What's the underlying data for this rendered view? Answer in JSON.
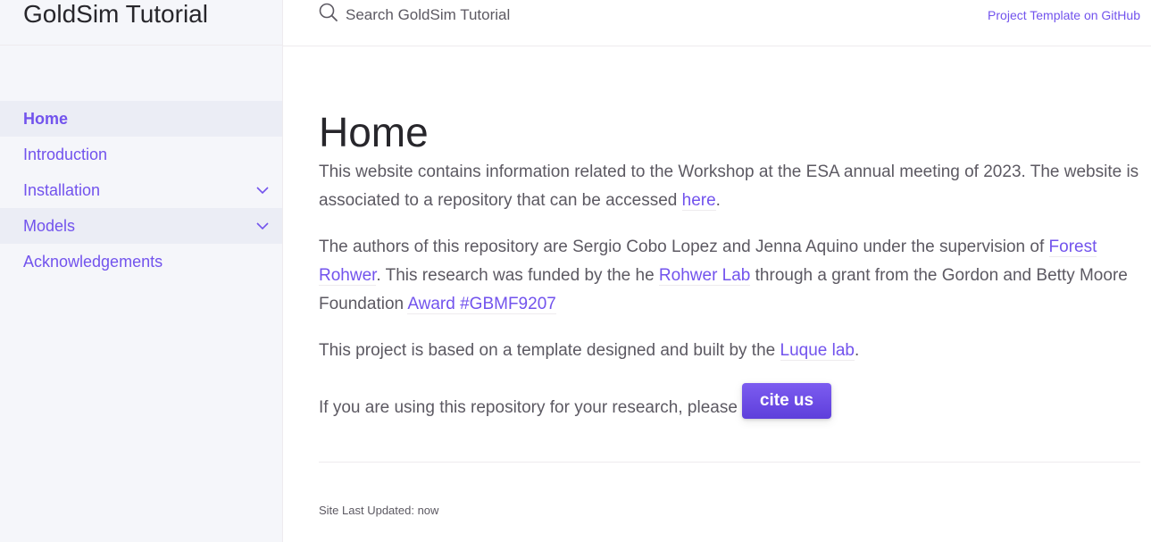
{
  "site": {
    "title": "GoldSim Tutorial"
  },
  "search": {
    "placeholder": "Search GoldSim Tutorial"
  },
  "aux": {
    "github_link": "Project Template on GitHub"
  },
  "nav": {
    "home": "Home",
    "introduction": "Introduction",
    "installation": "Installation",
    "models": "Models",
    "acknowledgements": "Acknowledgements"
  },
  "content": {
    "title": "Home",
    "p1_a": "This website contains information related to the Workshop at the ESA annual meeting of 2023. The website is associated to a repository that can be accessed ",
    "p1_link": "here",
    "p1_b": ".",
    "p2_a": "The authors of this repository are Sergio Cobo Lopez and Jenna Aquino under the supervision of ",
    "p2_link1": "Forest Rohwer",
    "p2_b": ". This research was funded by the he ",
    "p2_link2": "Rohwer Lab",
    "p2_c": " through a grant from the Gordon and Betty Moore Foundation ",
    "p2_link3": "Award #GBMF9207",
    "p3_a": "This project is based on a template designed and built by the ",
    "p3_link": "Luque lab",
    "p3_b": ".",
    "p4_a": "If you are using this repository for your research, please ",
    "cite_button": "cite us"
  },
  "footer": {
    "last_updated": "Site Last Updated: now"
  },
  "colors": {
    "accent": "#7253ed",
    "sidebar_bg": "#f5f6fa",
    "active_bg": "#ebedf5"
  },
  "icons": {
    "search": "search-icon",
    "chevron": "chevron-down-icon"
  }
}
